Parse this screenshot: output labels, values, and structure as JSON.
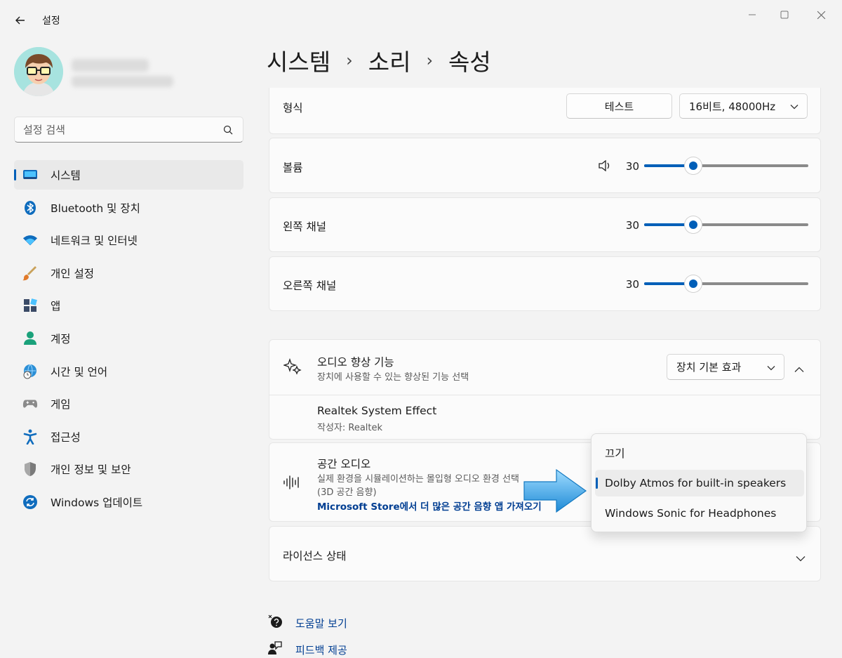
{
  "window": {
    "title": "설정"
  },
  "search": {
    "placeholder": "설정 검색"
  },
  "sidebar": {
    "items": [
      {
        "label": "시스템",
        "icon": "system-icon"
      },
      {
        "label": "Bluetooth 및 장치",
        "icon": "bluetooth-icon"
      },
      {
        "label": "네트워크 및 인터넷",
        "icon": "wifi-icon"
      },
      {
        "label": "개인 설정",
        "icon": "brush-icon"
      },
      {
        "label": "앱",
        "icon": "apps-icon"
      },
      {
        "label": "계정",
        "icon": "account-icon"
      },
      {
        "label": "시간 및 언어",
        "icon": "globe-clock-icon"
      },
      {
        "label": "게임",
        "icon": "gamepad-icon"
      },
      {
        "label": "접근성",
        "icon": "accessibility-icon"
      },
      {
        "label": "개인 정보 및 보안",
        "icon": "shield-icon"
      },
      {
        "label": "Windows 업데이트",
        "icon": "update-icon"
      }
    ]
  },
  "breadcrumb": [
    "시스템",
    "소리",
    "속성"
  ],
  "format": {
    "label": "형식",
    "test_button": "테스트",
    "value": "16비트, 48000Hz"
  },
  "volume": {
    "label": "볼륨",
    "value": "30",
    "level": 0.3
  },
  "left_channel": {
    "label": "왼쪽 채널",
    "value": "30",
    "level": 0.3
  },
  "right_channel": {
    "label": "오른쪽 채널",
    "value": "30",
    "level": 0.3
  },
  "audio_enhancement": {
    "title": "오디오 향상 기능",
    "subtitle": "장치에 사용할 수 있는 향상된 기능 선택",
    "dropdown": "장치 기본 효과",
    "effect_name": "Realtek System Effect",
    "effect_publisher": "작성자: Realtek"
  },
  "spatial_audio": {
    "title": "공간 오디오",
    "description": "실제 환경을 시뮬레이션하는 몰입형 오디오 환경 선택",
    "description2": "(3D 공간 음향)",
    "link": "Microsoft Store에서 더 많은 공간 음향 앱 가져오기"
  },
  "spatial_menu": {
    "items": [
      "끄기",
      "Dolby Atmos for built-in speakers",
      "Windows Sonic for Headphones"
    ],
    "selected_index": 1
  },
  "license": {
    "label": "라이선스 상태"
  },
  "footer": {
    "help": "도움말 보기",
    "feedback": "피드백 제공"
  },
  "colors": {
    "accent": "#005fb8",
    "arrow": "#3aa6ea"
  }
}
